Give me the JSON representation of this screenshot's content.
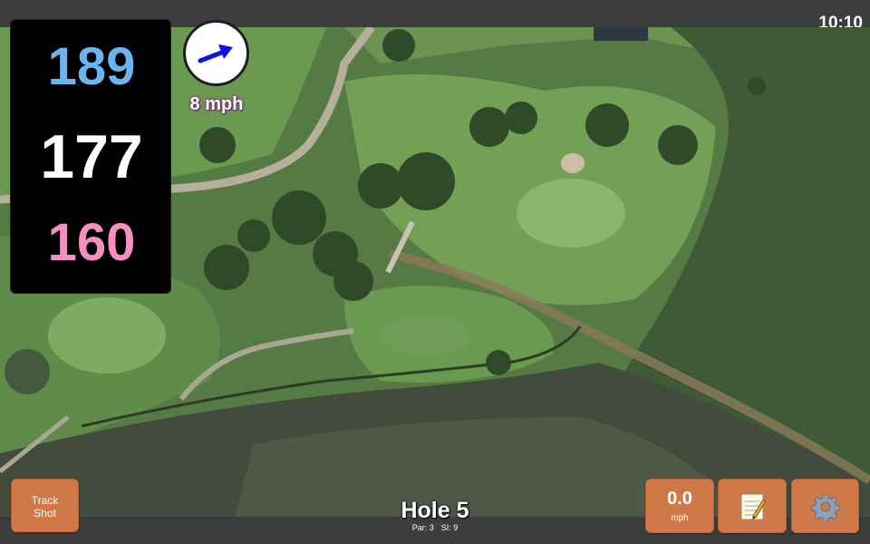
{
  "status": {
    "time": "10:10"
  },
  "distances": {
    "back": "189",
    "middle": "177",
    "front": "160"
  },
  "wind": {
    "speed": "8 mph",
    "icon": "wind-direction-arrow-icon"
  },
  "hole": {
    "title": "Hole 5",
    "par": "Par: 3",
    "si": "SI: 9"
  },
  "buttons": {
    "track_line1": "Track",
    "track_line2": "Shot",
    "speed_value": "0.0",
    "speed_unit": "mph",
    "notes_icon": "notepad-icon",
    "settings_icon": "gear-icon"
  },
  "colors": {
    "back": "#6ab4f0",
    "middle": "#ffffff",
    "front": "#f48fc1",
    "button": "#d07848",
    "bar": "#3d3d3d"
  }
}
